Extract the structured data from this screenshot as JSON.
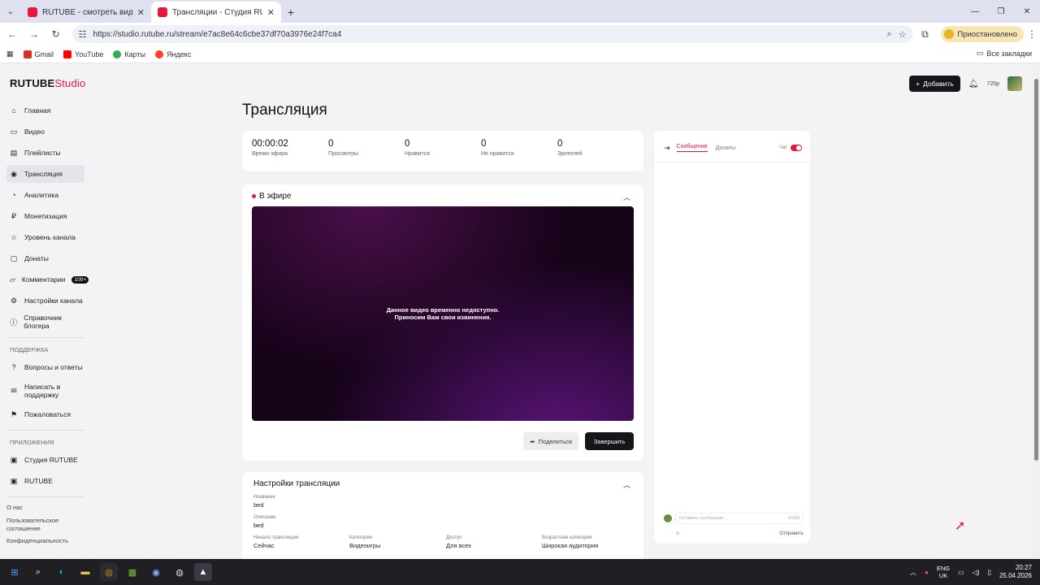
{
  "browser": {
    "tabs": [
      {
        "title": "RUTUBE - смотреть видео онл...",
        "active": false
      },
      {
        "title": "Трансляции - Студия RUTUBE",
        "active": true
      }
    ],
    "url": "https://studio.rutube.ru/stream/e7ac8e64c6cbe37df70a3976e24f7ca4",
    "profile_label": "Приостановлено",
    "bookmarks": [
      "Gmail",
      "YouTube",
      "Карты",
      "Яндекс"
    ],
    "all_bookmarks": "Все закладки"
  },
  "app": {
    "logo_text": "RUTUBE",
    "logo_suffix": "Studio",
    "add_button": "Добавить",
    "quality": "720p"
  },
  "sidebar": {
    "items": [
      {
        "label": "Главная",
        "icon": "home-icon"
      },
      {
        "label": "Видео",
        "icon": "video-icon"
      },
      {
        "label": "Плейлисты",
        "icon": "playlist-icon"
      },
      {
        "label": "Трансляция",
        "icon": "broadcast-icon",
        "active": true
      },
      {
        "label": "Аналитика",
        "icon": "analytics-icon"
      },
      {
        "label": "Монетизация",
        "icon": "money-icon"
      },
      {
        "label": "Уровень канала",
        "icon": "star-icon"
      },
      {
        "label": "Донаты",
        "icon": "donate-icon"
      },
      {
        "label": "Комментарии",
        "icon": "comment-icon",
        "badge": "100+"
      },
      {
        "label": "Настройки канала",
        "icon": "gear-icon"
      },
      {
        "label": "Справочник блогера",
        "icon": "info-icon"
      }
    ],
    "support_heading": "ПОДДЕРЖКА",
    "support_items": [
      {
        "label": "Вопросы и ответы",
        "icon": "question-icon"
      },
      {
        "label": "Написать в поддержку",
        "icon": "mail-icon"
      },
      {
        "label": "Пожаловаться",
        "icon": "flag-icon"
      }
    ],
    "apps_heading": "ПРИЛОЖЕНИЯ",
    "apps_items": [
      {
        "label": "Студия RUTUBE",
        "icon": "app-icon"
      },
      {
        "label": "RUTUBE",
        "icon": "app-icon"
      }
    ],
    "footer": [
      "О нас",
      "Пользовательское соглашение",
      "Конфиденциальность"
    ]
  },
  "main": {
    "title": "Трансляция",
    "stats": [
      {
        "value": "00:00:02",
        "label": "Время эфира"
      },
      {
        "value": "0",
        "label": "Просмотры"
      },
      {
        "value": "0",
        "label": "Нравится"
      },
      {
        "value": "0",
        "label": "Не нравится"
      },
      {
        "value": "0",
        "label": "Зрителей"
      }
    ],
    "live_label": "В эфире",
    "player_message_1": "Данное видео временно недоступно.",
    "player_message_2": "Приносим Вам свои извинения.",
    "share_button": "Поделиться",
    "finish_button": "Завершить",
    "settings_title": "Настройки трансляции",
    "settings": {
      "name_label": "Название",
      "name_value": "bed",
      "desc_label": "Описание",
      "desc_value": "bed",
      "start_label": "Начало трансляции",
      "start_value": "Сейчас",
      "category_label": "Категория",
      "category_value": "Видеоигры",
      "access_label": "Доступ",
      "access_value": "Для всех",
      "age_label": "Возрастная категория",
      "age_value": "Широкая аудитория"
    }
  },
  "chat": {
    "tab_messages": "Сообщения",
    "tab_donations": "Донаты",
    "chat_label": "Чат",
    "input_placeholder": "Оставить сообщение...",
    "counter": "0/200",
    "send": "Отправить"
  },
  "taskbar": {
    "lang_1": "ENG",
    "lang_2": "UK",
    "time": "20:27",
    "date": "25.04.2026"
  }
}
